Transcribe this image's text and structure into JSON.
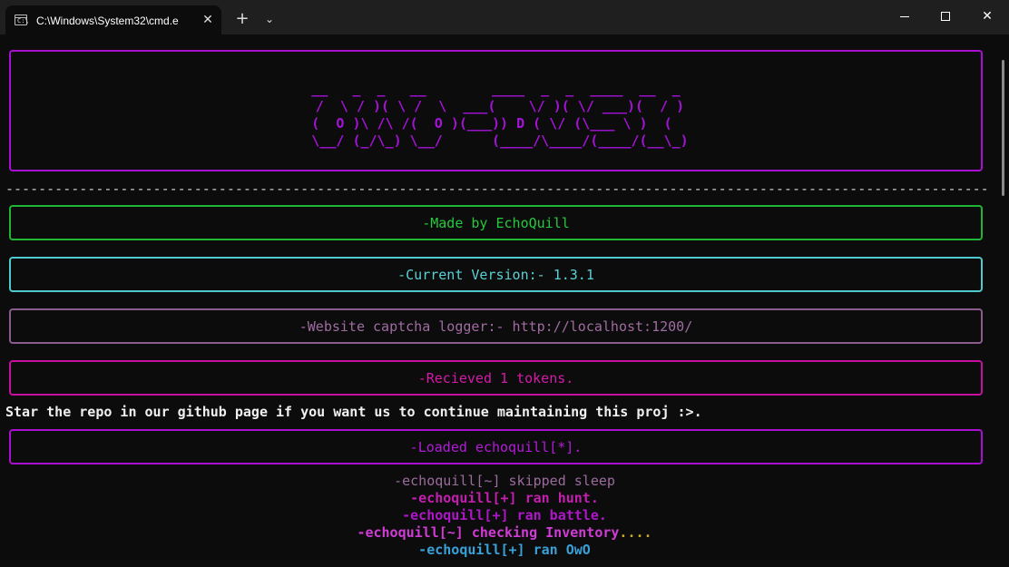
{
  "window": {
    "tab_title": "C:\\Windows\\System32\\cmd.e",
    "tab_icon_text": "C:\\",
    "close_tab": "✕",
    "new_tab": "+",
    "dropdown": "⌄",
    "close_window": "✕"
  },
  "banner": {
    "ascii": " __   _  _   __        ____  _  _  ____  __  _ \n /  \\ / )( \\ /  \\  ___(    \\/ )( \\/ ___)(  / )\n(  O )\\ /\\ /(  O )(___)) D ( \\/ (\\___ \\ )  ( \n \\__/ (_/\\_) \\__/      (____/\\____/(____/(__\\_)"
  },
  "separator": "------------------------------------------------------------------------------------------------------------------------------------------------------",
  "boxes": {
    "made_by": "-Made by EchoQuill",
    "version": "-Current Version:- 1.3.1",
    "website": "-Website captcha logger:- http://localhost:1200/",
    "tokens": "-Recieved 1 tokens.",
    "loaded": "-Loaded echoquill[*]."
  },
  "notice": "Star the repo in our github page if you want us to continue maintaining this proj :>.",
  "log": {
    "line1": "-echoquill[~] skipped sleep",
    "line2": "-echoquill[+] ran hunt.",
    "line3": "-echoquill[+] ran battle.",
    "line4_a": "-echoquill[~] checking Inventory",
    "line4_b": "....",
    "line5": "-echoquill[+] ran OwO"
  },
  "colors": {
    "banner": "#a512d8",
    "made_by": "#26c93d",
    "version": "#5ad2d5",
    "website": "#9f6ca1",
    "tokens": "#d51aa9",
    "loaded": "#b21bd9",
    "inventory": "#d13bd6",
    "inventory_dots": "#c8a82d",
    "owo": "#3aa0d8"
  }
}
